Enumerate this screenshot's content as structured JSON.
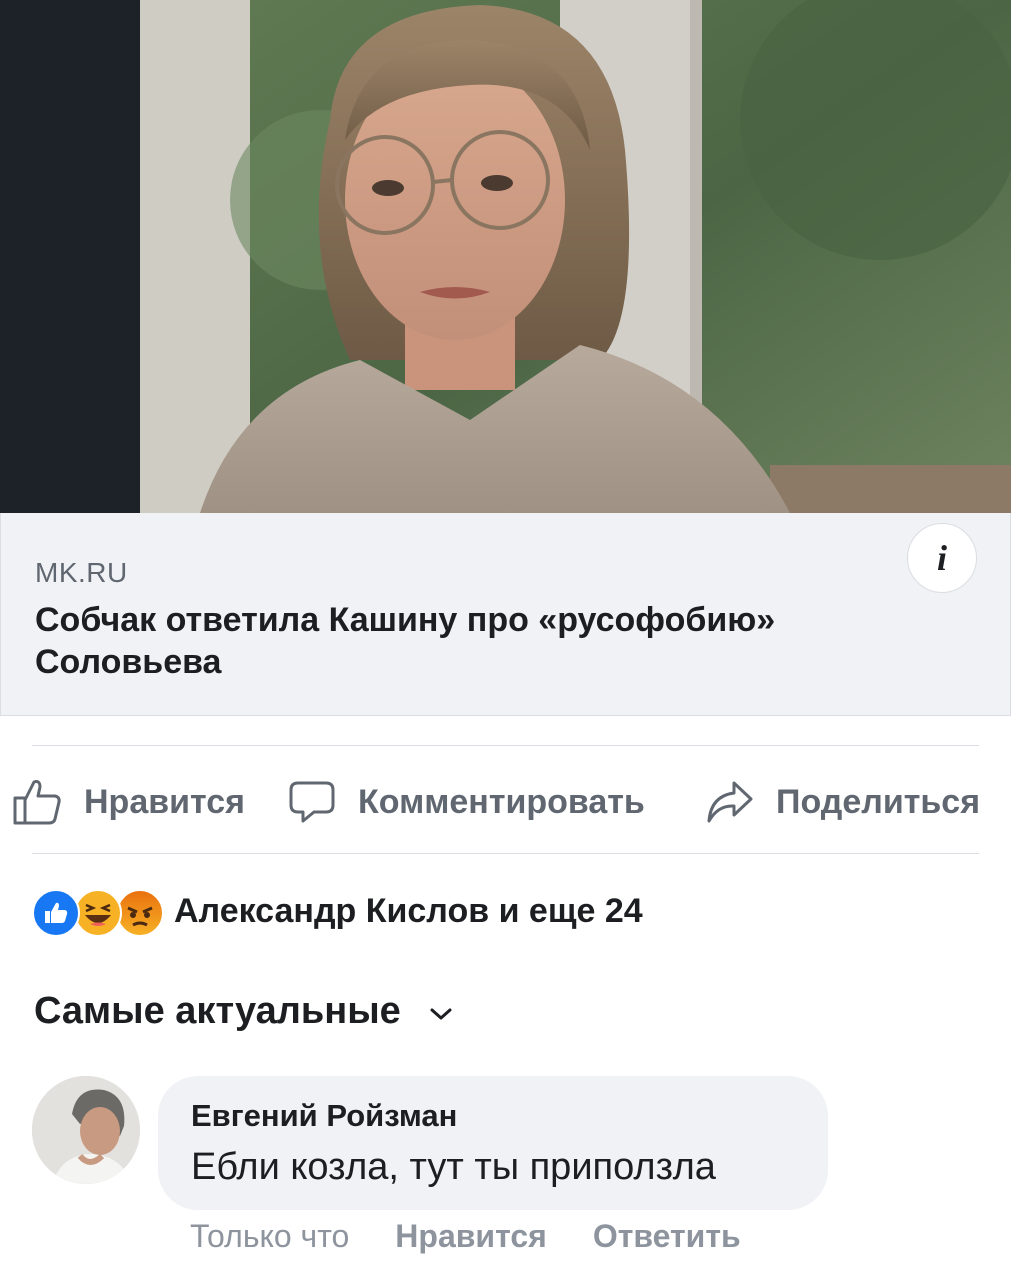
{
  "link_preview": {
    "image_alt": "photo-woman-glasses",
    "domain": "MK.RU",
    "title": "Собчак ответила Кашину про «русофобию» Соловьева",
    "info_icon": "info-icon"
  },
  "actions": {
    "like_label": "Нравится",
    "comment_label": "Комментировать",
    "share_label": "Поделиться",
    "like_icon": "thumbs-up-icon",
    "comment_icon": "speech-bubble-icon",
    "share_icon": "share-arrow-icon"
  },
  "reactions": {
    "icons": [
      "like-reaction-icon",
      "haha-reaction-icon",
      "angry-reaction-icon"
    ],
    "summary": "Александр Кислов и еще 24"
  },
  "sort": {
    "label": "Самые актуальные",
    "icon": "chevron-down-icon"
  },
  "comments": [
    {
      "author": "Евгений Ройзман",
      "text": "Ебли козла, тут ты приползла",
      "time": "Только что",
      "like_label": "Нравится",
      "reply_label": "Ответить"
    }
  ],
  "colors": {
    "card_background": "#f0f2f5",
    "secondary_text": "#606770",
    "meta_text": "#8d949e",
    "like_blue": "#1877f2",
    "reaction_yellow": "#f7b125",
    "reaction_orange": "#e9710f"
  }
}
